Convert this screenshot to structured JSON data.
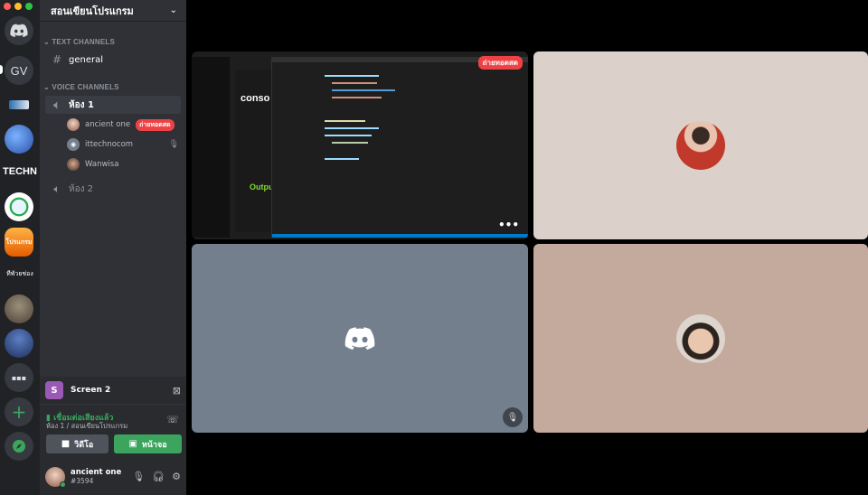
{
  "server": {
    "name": "สอนเขียนโปรแกรม"
  },
  "rail": {
    "gv_label": "GV",
    "techn_label": "TECHN",
    "server_label_a": "โปรแกรม",
    "server_label_b": "ทีพัวยช่อง"
  },
  "sidebar": {
    "text_category": "TEXT CHANNELS",
    "voice_category": "VOICE CHANNELS",
    "text_channels": [
      {
        "name": "general"
      }
    ],
    "voice_channels": [
      {
        "name": "ห้อง 1"
      },
      {
        "name": "ห้อง 2"
      }
    ],
    "voice_users": [
      {
        "name": "ancient one",
        "badge": "ถ่ายทอดสด"
      },
      {
        "name": "ittechnocom"
      },
      {
        "name": "Wanwisa"
      }
    ]
  },
  "screen_panel": {
    "label": "Screen 2",
    "icon_letter": "S"
  },
  "voice_panel": {
    "status": "เชื่อมต่อเสียงแล้ว",
    "location": "ห้อง 1 / สอนเขียนโปรแกรม",
    "video_label": "วิดีโอ",
    "screen_label": "หน้าจอ"
  },
  "user": {
    "name": "ancient one",
    "tag": "#3594"
  },
  "stage": {
    "live_label": "ถ่ายทอดสด",
    "slide_title": "conso",
    "slide_output": "Outpu"
  },
  "colors": {
    "blurple": "#5865f2",
    "green": "#3ba55d",
    "red": "#ed4245"
  }
}
